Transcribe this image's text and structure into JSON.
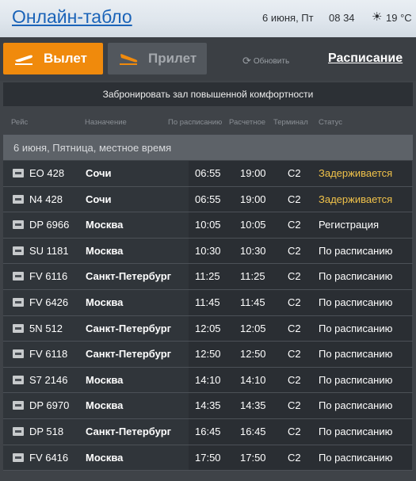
{
  "header": {
    "title": "Онлайн-табло",
    "date": "6 июня, Пт",
    "time": "08 34",
    "temperature": "19 °C",
    "weather_icon": "sun-icon"
  },
  "tabs": {
    "departures": "Вылет",
    "arrivals": "Прилет",
    "refresh": "Обновить",
    "schedule": "Расписание"
  },
  "banner": {
    "label": "Забронировать зал повышенной комфортности"
  },
  "columns": {
    "flight": "Рейс",
    "destination": "Назначение",
    "scheduled": "По расписанию",
    "estimated": "Расчетное",
    "terminal": "Терминал",
    "status": "Статус"
  },
  "day_label": "6 июня, Пятница, местное время",
  "colors": {
    "accent": "#f08a0c",
    "delayed": "#f0c24a",
    "title_link": "#1a63b8"
  },
  "flights": [
    {
      "flight": "EO 428",
      "dest": "Сочи",
      "sched": "06:55",
      "est": "19:00",
      "term": "C2",
      "status": "Задерживается",
      "delayed": true
    },
    {
      "flight": "N4 428",
      "dest": "Сочи",
      "sched": "06:55",
      "est": "19:00",
      "term": "C2",
      "status": "Задерживается",
      "delayed": true
    },
    {
      "flight": "DP 6966",
      "dest": "Москва",
      "sched": "10:05",
      "est": "10:05",
      "term": "C2",
      "status": "Регистрация",
      "delayed": false
    },
    {
      "flight": "SU 1181",
      "dest": "Москва",
      "sched": "10:30",
      "est": "10:30",
      "term": "C2",
      "status": "По расписанию",
      "delayed": false
    },
    {
      "flight": "FV 6116",
      "dest": "Санкт-Петербург",
      "sched": "11:25",
      "est": "11:25",
      "term": "C2",
      "status": "По расписанию",
      "delayed": false
    },
    {
      "flight": "FV 6426",
      "dest": "Москва",
      "sched": "11:45",
      "est": "11:45",
      "term": "C2",
      "status": "По расписанию",
      "delayed": false
    },
    {
      "flight": "5N 512",
      "dest": "Санкт-Петербург",
      "sched": "12:05",
      "est": "12:05",
      "term": "C2",
      "status": "По расписанию",
      "delayed": false
    },
    {
      "flight": "FV 6118",
      "dest": "Санкт-Петербург",
      "sched": "12:50",
      "est": "12:50",
      "term": "C2",
      "status": "По расписанию",
      "delayed": false
    },
    {
      "flight": "S7 2146",
      "dest": "Москва",
      "sched": "14:10",
      "est": "14:10",
      "term": "C2",
      "status": "По расписанию",
      "delayed": false
    },
    {
      "flight": "DP 6970",
      "dest": "Москва",
      "sched": "14:35",
      "est": "14:35",
      "term": "C2",
      "status": "По расписанию",
      "delayed": false
    },
    {
      "flight": "DP 518",
      "dest": "Санкт-Петербург",
      "sched": "16:45",
      "est": "16:45",
      "term": "C2",
      "status": "По расписанию",
      "delayed": false
    },
    {
      "flight": "FV 6416",
      "dest": "Москва",
      "sched": "17:50",
      "est": "17:50",
      "term": "C2",
      "status": "По расписанию",
      "delayed": false
    }
  ]
}
